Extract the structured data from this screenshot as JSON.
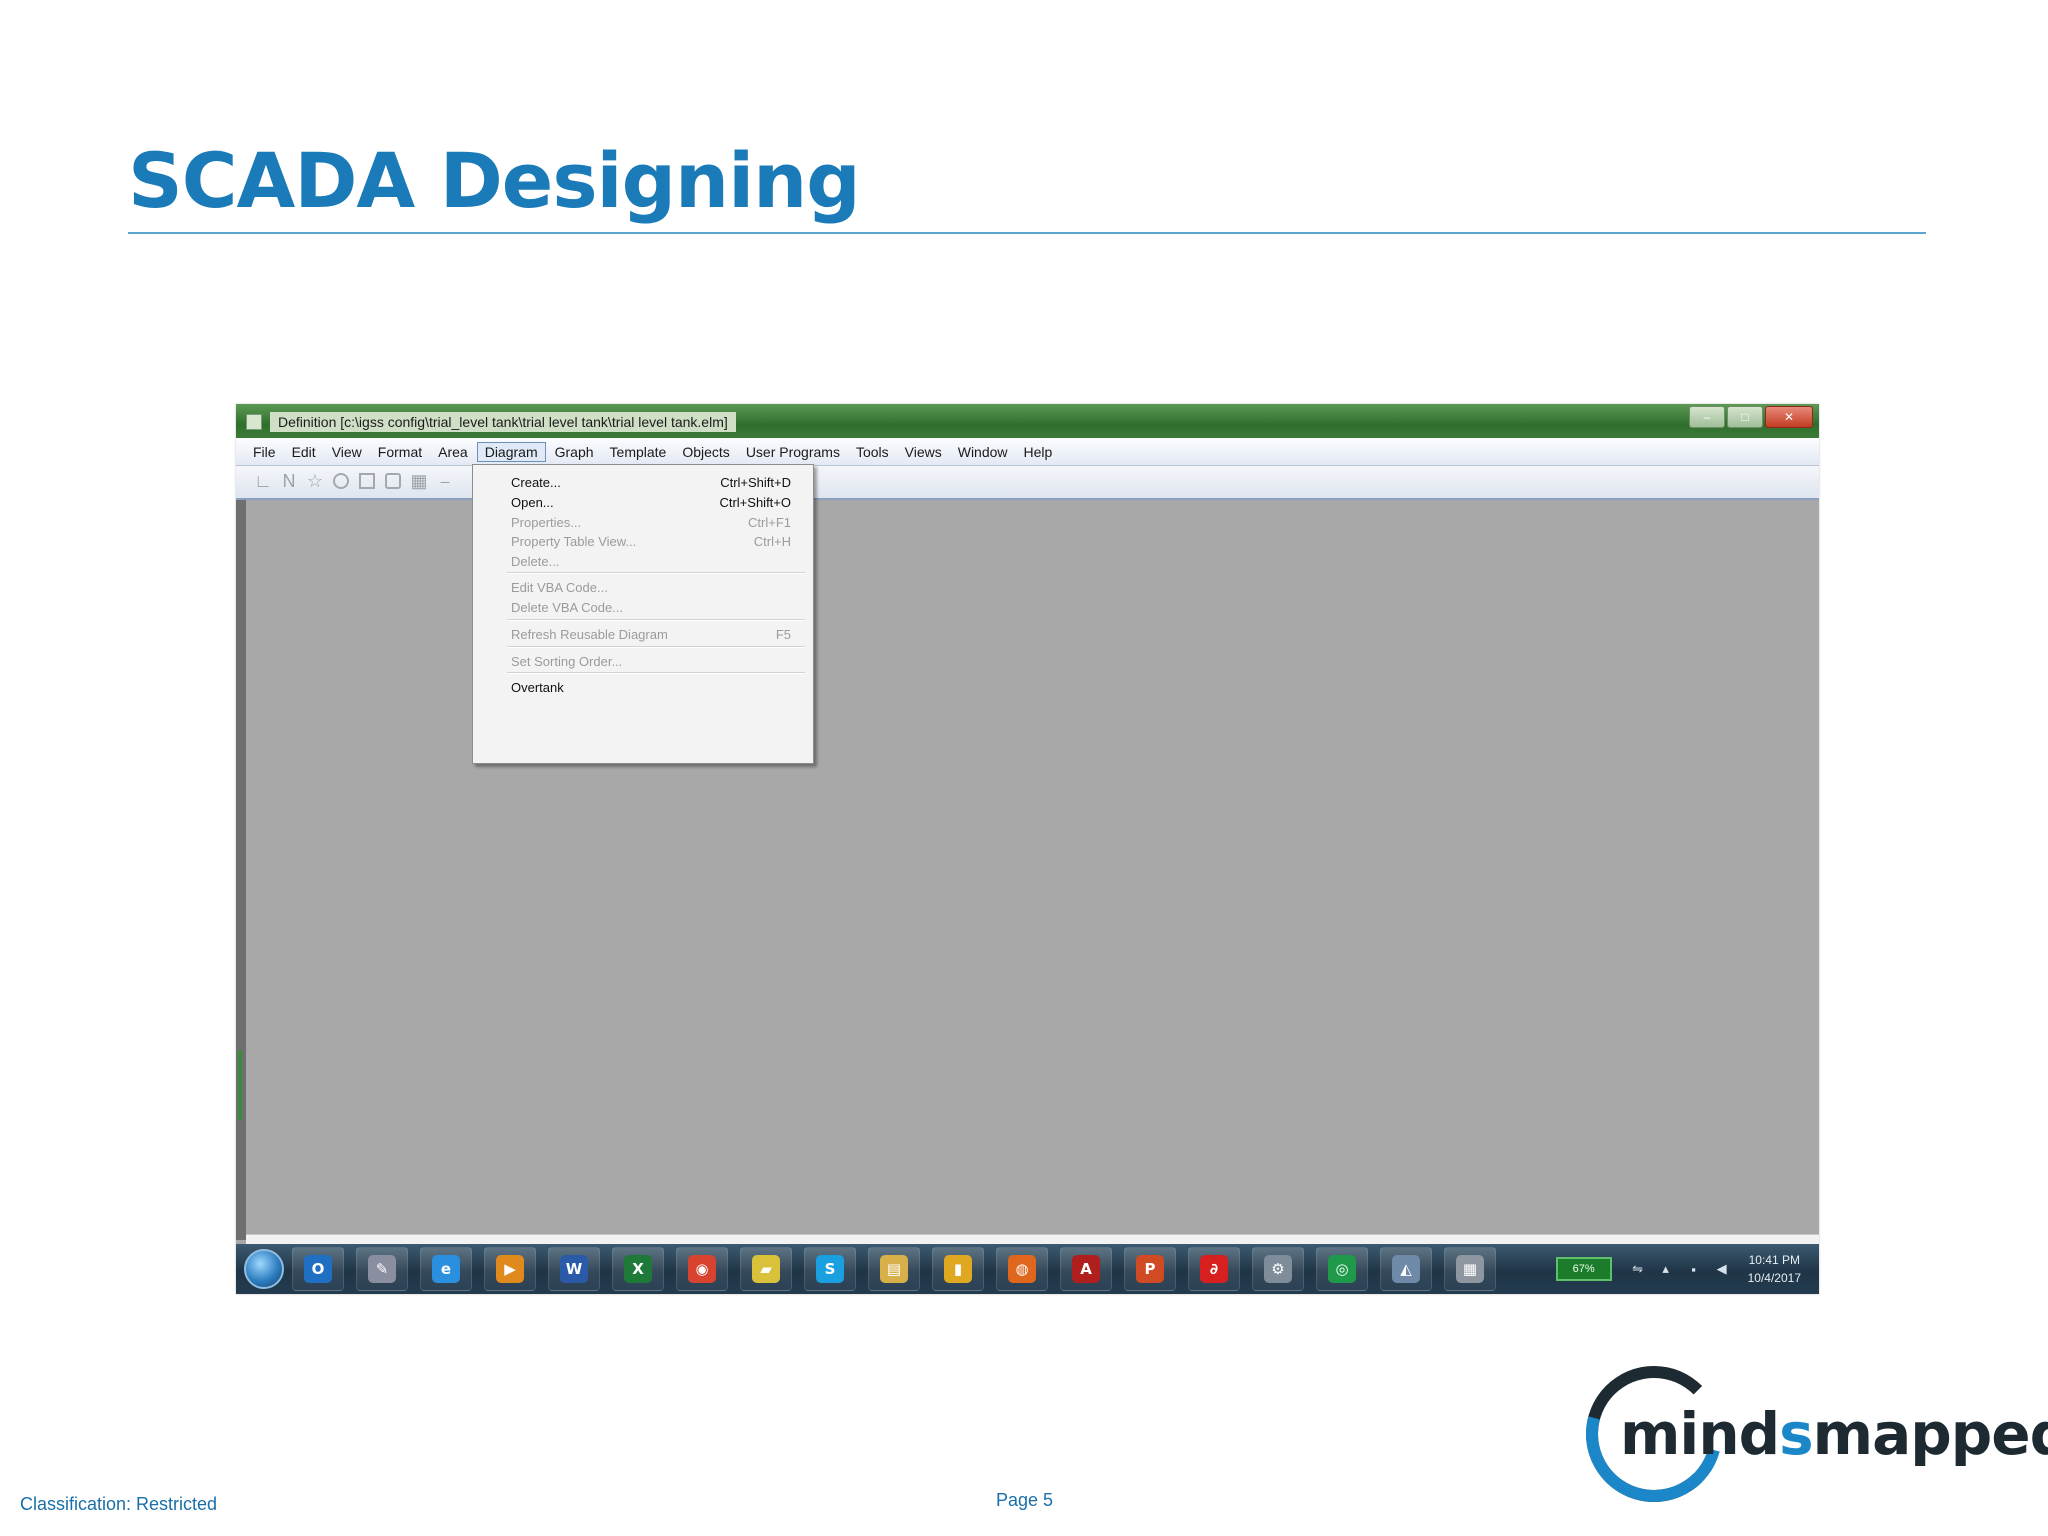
{
  "slide": {
    "title": "SCADA Designing",
    "classification": "Classification: Restricted",
    "page": "Page 5"
  },
  "logo": {
    "part1": "mind",
    "part2": "s",
    "part3": "mapped"
  },
  "window": {
    "title": "Definition [c:\\igss config\\trial_level tank\\trial level tank\\trial level tank.elm]",
    "minimize": "–",
    "maximize": "□",
    "close": "✕"
  },
  "menubar": [
    {
      "label": "File"
    },
    {
      "label": "Edit"
    },
    {
      "label": "View"
    },
    {
      "label": "Format"
    },
    {
      "label": "Area"
    },
    {
      "label": "Diagram"
    },
    {
      "label": "Graph"
    },
    {
      "label": "Template"
    },
    {
      "label": "Objects"
    },
    {
      "label": "User Programs"
    },
    {
      "label": "Tools"
    },
    {
      "label": "Views"
    },
    {
      "label": "Window"
    },
    {
      "label": "Help"
    }
  ],
  "toolbar_icons": [
    "line-tool-icon",
    "n-tool-icon",
    "star-tool-icon",
    "ellipse-tool-icon",
    "rectangle-tool-icon",
    "rounded-rect-tool-icon",
    "image-tool-icon",
    "more-tools-icon"
  ],
  "diagram_menu": [
    {
      "label": "Create...",
      "shortcut": "Ctrl+Shift+D",
      "enabled": true
    },
    {
      "label": "Open...",
      "shortcut": "Ctrl+Shift+O",
      "enabled": true
    },
    {
      "label": "Properties...",
      "shortcut": "Ctrl+F1",
      "enabled": false
    },
    {
      "label": "Property Table View...",
      "shortcut": "Ctrl+H",
      "enabled": false
    },
    {
      "label": "Delete...",
      "shortcut": "",
      "enabled": false
    },
    {
      "label": "Edit VBA Code...",
      "shortcut": "",
      "enabled": false
    },
    {
      "label": "Delete VBA Code...",
      "shortcut": "",
      "enabled": false
    },
    {
      "label": "Refresh Reusable Diagram",
      "shortcut": "F5",
      "enabled": false
    },
    {
      "label": "Set Sorting Order...",
      "shortcut": "",
      "enabled": false
    },
    {
      "label": "Overtank",
      "shortcut": "",
      "enabled": true
    }
  ],
  "taskbar": {
    "apps": [
      {
        "name": "outlook-icon",
        "glyph": "O",
        "color": "#1f6fc2"
      },
      {
        "name": "paint-icon",
        "glyph": "✎",
        "color": "#8a8fa0"
      },
      {
        "name": "internet-explorer-icon",
        "glyph": "e",
        "color": "#2b8fe0"
      },
      {
        "name": "media-player-icon",
        "glyph": "▶",
        "color": "#e08a1e"
      },
      {
        "name": "word-icon",
        "glyph": "W",
        "color": "#2b5aa8"
      },
      {
        "name": "excel-icon",
        "glyph": "X",
        "color": "#1f7a3a"
      },
      {
        "name": "chrome-icon",
        "glyph": "◉",
        "color": "#d8432f"
      },
      {
        "name": "sticky-notes-icon",
        "glyph": "▰",
        "color": "#d9c23a"
      },
      {
        "name": "skype-icon",
        "glyph": "S",
        "color": "#1aa0e0"
      },
      {
        "name": "file-explorer-icon",
        "glyph": "▤",
        "color": "#d7b04a"
      },
      {
        "name": "notes-icon",
        "glyph": "▮",
        "color": "#e0a820"
      },
      {
        "name": "firefox-icon",
        "glyph": "◍",
        "color": "#e0661e"
      },
      {
        "name": "acrobat-icon",
        "glyph": "A",
        "color": "#b01e1e"
      },
      {
        "name": "powerpoint-icon",
        "glyph": "P",
        "color": "#d04a24"
      },
      {
        "name": "airtel-icon",
        "glyph": "∂",
        "color": "#d82020"
      },
      {
        "name": "settings-app-icon",
        "glyph": "⚙",
        "color": "#7f8c99"
      },
      {
        "name": "igss-icon",
        "glyph": "◎",
        "color": "#1f9a4a"
      },
      {
        "name": "design-app-icon",
        "glyph": "◭",
        "color": "#6f8aa8"
      },
      {
        "name": "calculator-icon",
        "glyph": "▦",
        "color": "#8e96a0"
      }
    ],
    "battery": "67%",
    "time": "10:41 PM",
    "date": "10/4/2017"
  }
}
